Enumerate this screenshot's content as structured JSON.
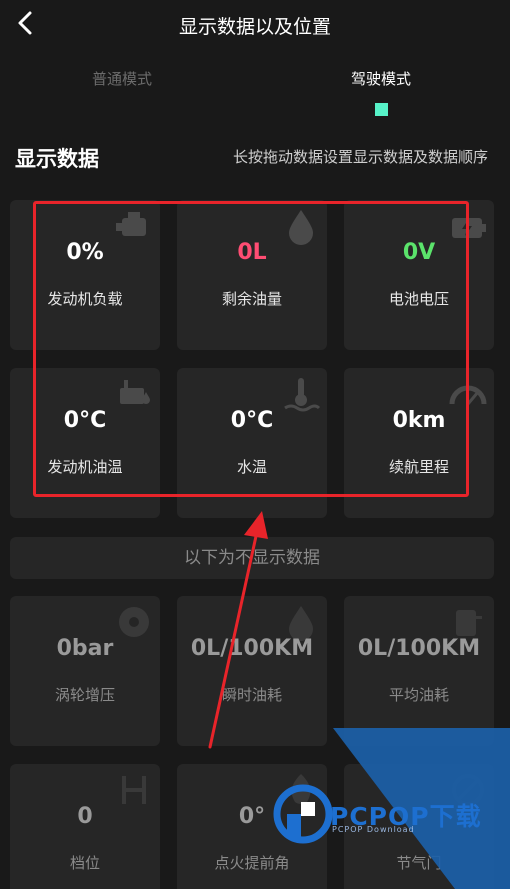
{
  "header": {
    "title": "显示数据以及位置"
  },
  "tabs": [
    {
      "label": "普通模式",
      "active": false
    },
    {
      "label": "驾驶模式",
      "active": true
    }
  ],
  "accent_color": "#57f2c8",
  "section": {
    "title": "显示数据",
    "hint": "长按拖动数据设置显示数据及数据顺序"
  },
  "shown": [
    {
      "value": "0%",
      "label": "发动机负载",
      "value_color": "#ffffff",
      "icon": "engine-icon"
    },
    {
      "value": "0L",
      "label": "剩余油量",
      "value_color": "#ff4d73",
      "icon": "fuel-drop-icon"
    },
    {
      "value": "0V",
      "label": "电池电压",
      "value_color": "#5be36b",
      "icon": "battery-bolt-icon"
    },
    {
      "value": "0°C",
      "label": "发动机油温",
      "value_color": "#ffffff",
      "icon": "oil-temp-icon"
    },
    {
      "value": "0°C",
      "label": "水温",
      "value_color": "#ffffff",
      "icon": "coolant-temp-icon"
    },
    {
      "value": "0km",
      "label": "续航里程",
      "value_color": "#ffffff",
      "icon": "speedometer-icon"
    }
  ],
  "divider": {
    "label": "以下为不显示数据"
  },
  "hidden": [
    {
      "value": "0bar",
      "label": "涡轮增压",
      "icon": "turbo-icon"
    },
    {
      "value": "0L/100KM",
      "label": "瞬时油耗",
      "icon": "fuel-drop-icon"
    },
    {
      "value": "0L/100KM",
      "label": "平均油耗",
      "icon": "fuel-gauge-icon"
    },
    {
      "value": "0",
      "label": "档位",
      "icon": "gear-shift-icon"
    },
    {
      "value": "0°",
      "label": "点火提前角",
      "icon": "ignition-icon"
    },
    {
      "value": "",
      "label": "节气门",
      "icon": "throttle-icon"
    }
  ],
  "watermark": {
    "text": "PCPOP下载",
    "sub": "PCPOP Download"
  },
  "annotation_color": "#e8242a"
}
